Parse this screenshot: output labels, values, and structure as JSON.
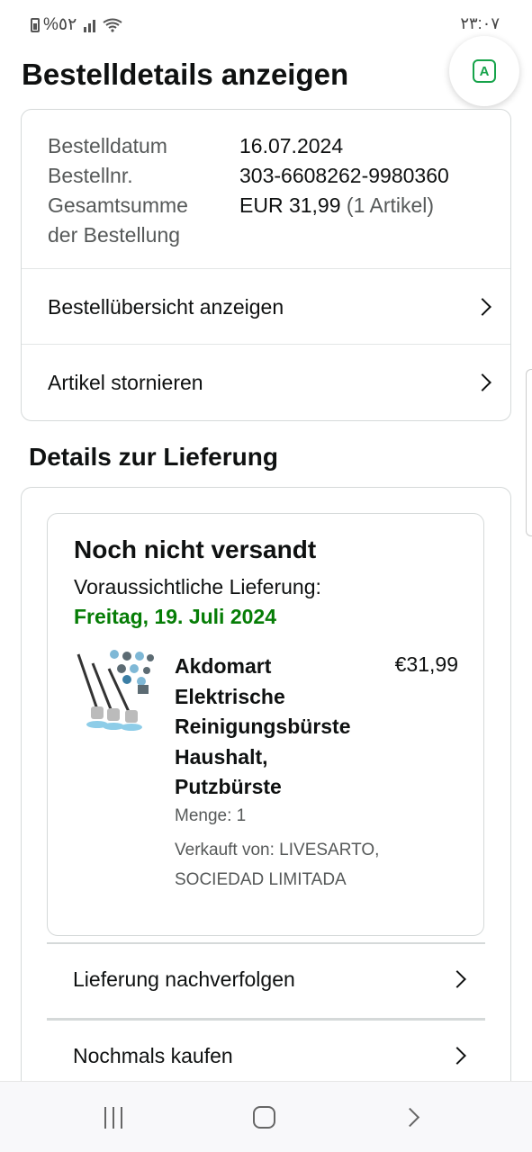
{
  "status_bar": {
    "battery_text": "%٥٢",
    "time": "٢٣:٠٧"
  },
  "fab": {
    "label": "A",
    "color": "#16a34a"
  },
  "page_title": "Bestelldetails anzeigen",
  "order_info": {
    "date_label": "Bestelldatum",
    "date_value": "16.07.2024",
    "number_label": "Bestellnr.",
    "number_value": "303-6608262-9980360",
    "total_label_line1": "Gesamtsumme",
    "total_label_line2": "der Bestellung",
    "total_value": "EUR 31,99",
    "total_count": "(1 Artikel)"
  },
  "order_actions": [
    {
      "label": "Bestellübersicht anzeigen"
    },
    {
      "label": "Artikel stornieren"
    }
  ],
  "delivery": {
    "section_title": "Details zur Lieferung",
    "status": "Noch nicht versandt",
    "eta_label": "Voraussichtliche Lieferung:",
    "eta_date": "Freitag, 19. Juli 2024",
    "eta_color": "#067d06",
    "product": {
      "title": "Akdomart Elektrische Reinigungsbürste Haushalt, Putzbürste",
      "price": "€31,99",
      "quantity": "Menge: 1",
      "seller": "Verkauft von: LIVESARTO, SOCIEDAD LIMITADA"
    },
    "actions": [
      {
        "label": "Lieferung nachverfolgen"
      },
      {
        "label": "Nochmals kaufen"
      }
    ]
  }
}
